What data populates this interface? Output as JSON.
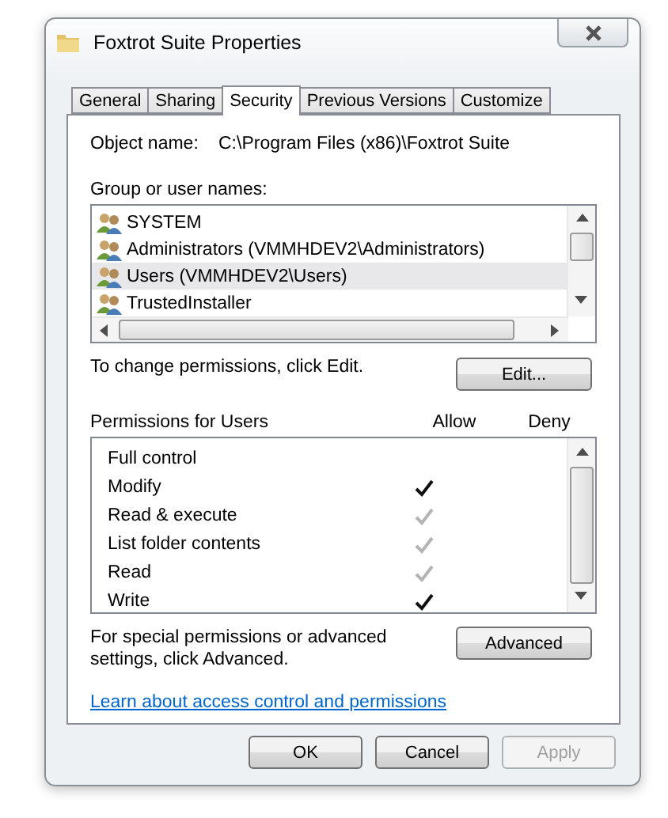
{
  "window": {
    "title": "Foxtrot Suite Properties"
  },
  "tabs": [
    {
      "label": "General",
      "selected": false
    },
    {
      "label": "Sharing",
      "selected": false
    },
    {
      "label": "Security",
      "selected": true
    },
    {
      "label": "Previous Versions",
      "selected": false
    },
    {
      "label": "Customize",
      "selected": false
    }
  ],
  "object_name": {
    "label": "Object name:",
    "value": "C:\\Program Files (x86)\\Foxtrot Suite"
  },
  "groups": {
    "label": "Group or user names:",
    "items": [
      {
        "name": "SYSTEM",
        "selected": false
      },
      {
        "name": "Administrators (VMMHDEV2\\Administrators)",
        "selected": false
      },
      {
        "name": "Users (VMMHDEV2\\Users)",
        "selected": true
      },
      {
        "name": "TrustedInstaller",
        "selected": false
      }
    ]
  },
  "edit_hint": "To change permissions, click Edit.",
  "edit_button": "Edit...",
  "permissions": {
    "label": "Permissions for Users",
    "allow_heading": "Allow",
    "deny_heading": "Deny",
    "items": [
      {
        "name": "Full control",
        "allow": false,
        "deny": false
      },
      {
        "name": "Modify",
        "allow": true,
        "allow_inherited": false,
        "deny": false
      },
      {
        "name": "Read & execute",
        "allow": true,
        "allow_inherited": true,
        "deny": false
      },
      {
        "name": "List folder contents",
        "allow": true,
        "allow_inherited": true,
        "deny": false
      },
      {
        "name": "Read",
        "allow": true,
        "allow_inherited": true,
        "deny": false
      },
      {
        "name": "Write",
        "allow": true,
        "allow_inherited": false,
        "deny": false
      }
    ]
  },
  "advanced_hint": "For special permissions or advanced settings, click Advanced.",
  "advanced_button": "Advanced",
  "link": "Learn about access control and permissions",
  "buttons": [
    {
      "label": "OK",
      "disabled": false
    },
    {
      "label": "Cancel",
      "disabled": false
    },
    {
      "label": "Apply",
      "disabled": true
    }
  ]
}
